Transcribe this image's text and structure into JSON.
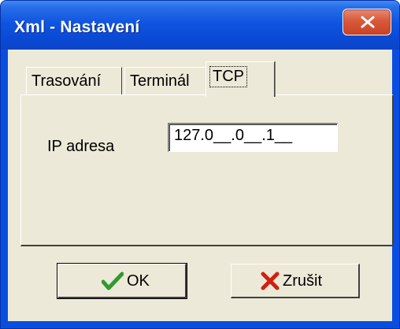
{
  "window": {
    "title": "Xml - Nastavení"
  },
  "tabs": [
    {
      "label": "Trasování",
      "active": false
    },
    {
      "label": "Terminál",
      "active": false
    },
    {
      "label": "TCP",
      "active": true
    }
  ],
  "tcp": {
    "ip_label": "IP adresa",
    "ip_value": "127.0__.0__.1__"
  },
  "buttons": {
    "ok_label": "OK",
    "cancel_label": "Zrušit"
  },
  "icons": {
    "close": "close-icon",
    "ok": "checkmark-icon",
    "cancel": "red-x-icon"
  },
  "colors": {
    "titlebar": "#0a4ad6",
    "close_button": "#d8593a",
    "dialog_face": "#ece9d8",
    "ok_check": "#2f9a2f",
    "cancel_x": "#d02010"
  }
}
